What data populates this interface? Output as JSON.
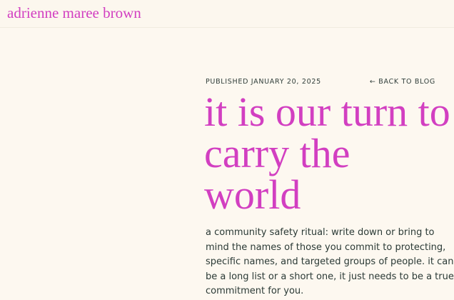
{
  "site": {
    "title": "adrienne maree brown"
  },
  "post": {
    "published": "PUBLISHED JANUARY 20, 2025",
    "back_link": "← BACK TO BLOG",
    "title": "it is our turn to carry the world",
    "excerpt": "a community safety ritual: write down or bring to mind the names of those you commit to protecting, specific names, and targeted groups of people. it can be a long list or a short one, it just needs to be a true commitment for you."
  },
  "colors": {
    "background": "#fdf8f0",
    "accent": "#d23fc1",
    "text": "#2b3a36"
  }
}
